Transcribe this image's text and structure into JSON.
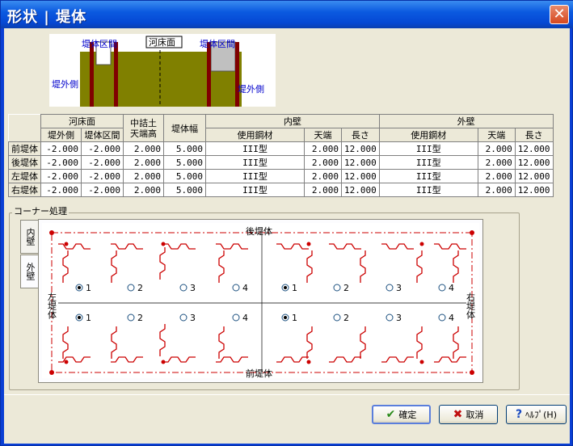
{
  "window": {
    "title": "形状 | 堤体",
    "close": "✕"
  },
  "diagram": {
    "left_section": "堤体区間",
    "right_section": "堤体区間",
    "center": "河床面",
    "outer_left": "堤外側",
    "outer_right": "堤外側"
  },
  "table": {
    "group_headers": {
      "riverbed": "河床面",
      "fill_top": "中詰土天端高",
      "fill_top_1": "中詰土",
      "fill_top_2": "天端高",
      "width": "堤体幅",
      "inner": "内壁",
      "outer": "外壁"
    },
    "sub_headers": {
      "outer_side": "堤外側",
      "section": "堤体区間",
      "inner_material": "使用鋼材",
      "inner_top": "天端",
      "inner_len": "長さ",
      "outer_material": "使用鋼材",
      "outer_top": "天端",
      "outer_len": "長さ"
    },
    "rows": [
      {
        "name": "前堤体",
        "c1": "-2.000",
        "c2": "-2.000",
        "c3": "2.000",
        "c4": "5.000",
        "c5": "III型",
        "c6": "2.000",
        "c7": "12.000",
        "c8": "III型",
        "c9": "2.000",
        "c10": "12.000"
      },
      {
        "name": "後堤体",
        "c1": "-2.000",
        "c2": "-2.000",
        "c3": "2.000",
        "c4": "5.000",
        "c5": "III型",
        "c6": "2.000",
        "c7": "12.000",
        "c8": "III型",
        "c9": "2.000",
        "c10": "12.000"
      },
      {
        "name": "左堤体",
        "c1": "-2.000",
        "c2": "-2.000",
        "c3": "2.000",
        "c4": "5.000",
        "c5": "III型",
        "c6": "2.000",
        "c7": "12.000",
        "c8": "III型",
        "c9": "2.000",
        "c10": "12.000"
      },
      {
        "name": "右堤体",
        "c1": "-2.000",
        "c2": "-2.000",
        "c3": "2.000",
        "c4": "5.000",
        "c5": "III型",
        "c6": "2.000",
        "c7": "12.000",
        "c8": "III型",
        "c9": "2.000",
        "c10": "12.000"
      }
    ]
  },
  "corner": {
    "group_label": "コーナー処理",
    "tabs": [
      "内壁",
      "外壁"
    ],
    "labels": {
      "top": "後堤体",
      "bottom": "前堤体",
      "left": "左堤体",
      "right": "右堤体"
    },
    "radio_options": [
      "1",
      "2",
      "3",
      "4"
    ],
    "selected": [
      "1",
      "1",
      "1",
      "1"
    ]
  },
  "buttons": {
    "ok": "確定",
    "cancel": "取消",
    "help": "ﾍﾙﾌﾟ(H)"
  },
  "colors": {
    "accent_red": "#cc0000",
    "olive": "#808000",
    "title_blue": "#0b5ae0",
    "label_blue": "#0000cc"
  }
}
